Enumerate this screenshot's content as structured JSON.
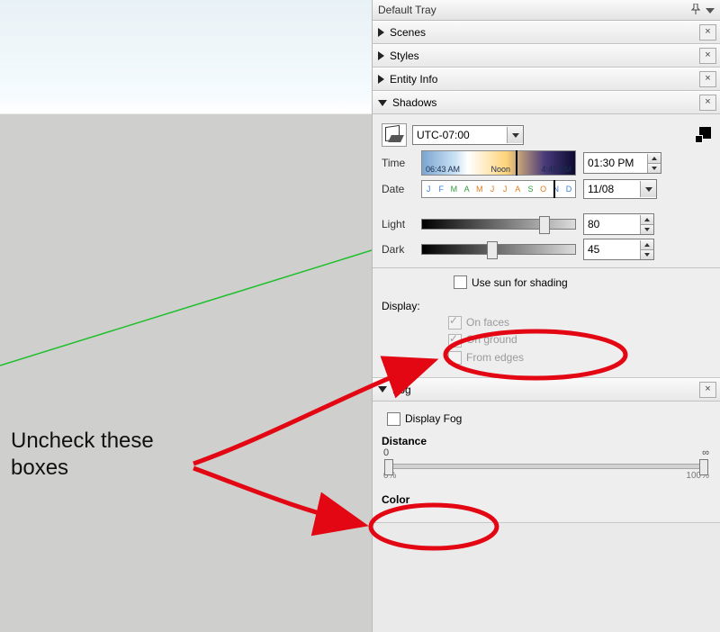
{
  "annotation": {
    "line1": "Uncheck these",
    "line2": "boxes"
  },
  "tray": {
    "title": "Default Tray"
  },
  "panels": {
    "scenes": {
      "label": "Scenes",
      "expanded": false
    },
    "styles": {
      "label": "Styles",
      "expanded": false
    },
    "entity": {
      "label": "Entity Info",
      "expanded": false
    },
    "shadows": {
      "label": "Shadows",
      "expanded": true
    },
    "fog": {
      "label": "Fog",
      "expanded": true
    }
  },
  "shadows": {
    "timezone": "UTC-07:00",
    "time_label": "Time",
    "time_ticks": [
      "06:43 AM",
      "Noon",
      "4:45 PM"
    ],
    "time_value": "01:30 PM",
    "date_label": "Date",
    "date_months": [
      "J",
      "F",
      "M",
      "A",
      "M",
      "J",
      "J",
      "A",
      "S",
      "O",
      "N",
      "D"
    ],
    "date_value": "11/08",
    "light_label": "Light",
    "light_value": "80",
    "dark_label": "Dark",
    "dark_value": "45",
    "use_sun_label": "Use sun for shading",
    "use_sun_checked": false,
    "display_label": "Display:",
    "on_faces": {
      "label": "On faces",
      "checked": true
    },
    "on_ground": {
      "label": "On ground",
      "checked": true
    },
    "from_edges": {
      "label": "From edges",
      "checked": false
    }
  },
  "fog": {
    "display_fog_label": "Display Fog",
    "display_fog_checked": false,
    "distance_label": "Distance",
    "dist_min": "0",
    "dist_max": "∞",
    "dist_min_sub": "0%",
    "dist_max_sub": "100%",
    "color_label": "Color"
  }
}
